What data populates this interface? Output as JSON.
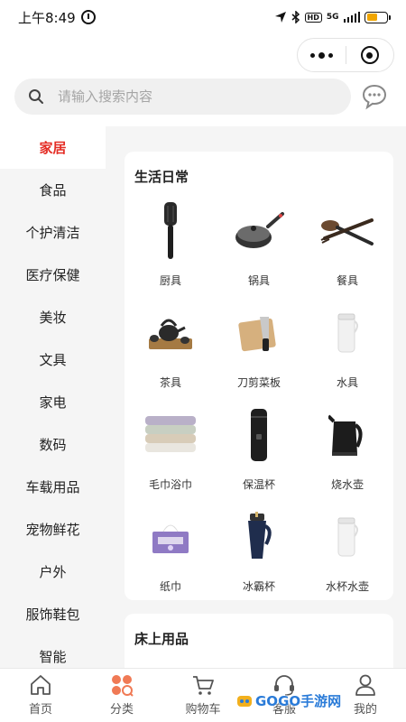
{
  "status": {
    "time": "上午8:49",
    "hd": "HD",
    "network": "5G",
    "icons": [
      "alarm-icon",
      "location-icon",
      "bluetooth-icon",
      "signal-icon",
      "battery-icon"
    ],
    "battery_level": 0.55
  },
  "capsule": {
    "icons": [
      "more-icon",
      "close-target-icon"
    ]
  },
  "search": {
    "placeholder": "请输入搜索内容",
    "icon": "search-icon",
    "chat_icon": "chat-icon"
  },
  "sidebar": {
    "items": [
      {
        "label": "家居",
        "active": true
      },
      {
        "label": "食品"
      },
      {
        "label": "个护清洁"
      },
      {
        "label": "医疗保健"
      },
      {
        "label": "美妆"
      },
      {
        "label": "文具"
      },
      {
        "label": "家电"
      },
      {
        "label": "数码"
      },
      {
        "label": "车载用品"
      },
      {
        "label": "宠物鲜花"
      },
      {
        "label": "户外"
      },
      {
        "label": "服饰鞋包"
      },
      {
        "label": "智能"
      }
    ]
  },
  "sections": [
    {
      "title": "生活日常",
      "items": [
        {
          "label": "厨具",
          "icon": "spatula-icon"
        },
        {
          "label": "锅具",
          "icon": "pan-icon"
        },
        {
          "label": "餐具",
          "icon": "cutlery-icon"
        },
        {
          "label": "茶具",
          "icon": "teaset-icon"
        },
        {
          "label": "刀剪菜板",
          "icon": "knife-board-icon"
        },
        {
          "label": "水具",
          "icon": "water-bottle-icon"
        },
        {
          "label": "毛巾浴巾",
          "icon": "towel-icon"
        },
        {
          "label": "保温杯",
          "icon": "thermos-icon"
        },
        {
          "label": "烧水壶",
          "icon": "kettle-icon"
        },
        {
          "label": "纸巾",
          "icon": "tissue-icon"
        },
        {
          "label": "冰霸杯",
          "icon": "tumbler-icon"
        },
        {
          "label": "水杯水壶",
          "icon": "cup-kettle-icon"
        }
      ]
    },
    {
      "title": "床上用品"
    }
  ],
  "tabbar": {
    "tabs": [
      {
        "label": "首页",
        "icon": "home-icon"
      },
      {
        "label": "分类",
        "icon": "category-icon",
        "active": true
      },
      {
        "label": "购物车",
        "icon": "cart-icon"
      },
      {
        "label": "客服",
        "icon": "service-icon"
      },
      {
        "label": "我的",
        "icon": "user-icon"
      }
    ]
  },
  "watermark": {
    "text": "GOGO手游网"
  },
  "colors": {
    "accent": "#e42c24",
    "sidebar_bg": "#f5f5f5",
    "category_icon": "#f07a55"
  }
}
